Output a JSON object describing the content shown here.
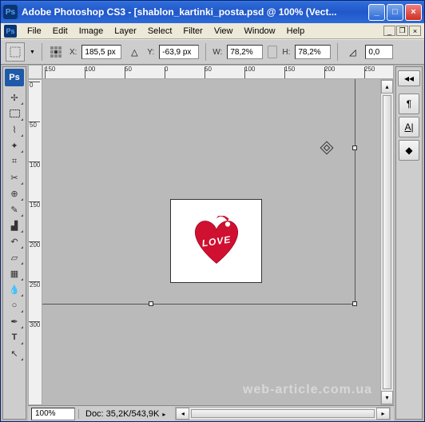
{
  "titlebar": {
    "app_icon": "Ps",
    "title": "Adobe Photoshop CS3 - [shablon_kartinki_posta.psd @ 100% (Vect..."
  },
  "menubar": {
    "icon": "Ps",
    "items": [
      "File",
      "Edit",
      "Image",
      "Layer",
      "Select",
      "Filter",
      "View",
      "Window",
      "Help"
    ]
  },
  "options": {
    "x_label": "X:",
    "x_value": "185,5 px",
    "y_label": "Y:",
    "y_value": "-63,9 px",
    "w_label": "W:",
    "w_value": "78,2%",
    "h_label": "H:",
    "h_value": "78,2%",
    "angle_value": "0,0"
  },
  "ruler_h": [
    "150",
    "100",
    "50",
    "0",
    "50",
    "100",
    "150",
    "200",
    "250"
  ],
  "ruler_v": [
    "0",
    "50",
    "100",
    "150",
    "200",
    "250",
    "300"
  ],
  "canvas": {
    "heart_text": "LOVE"
  },
  "status": {
    "zoom": "100%",
    "doc": "Doc: 35,2K/543,9K"
  },
  "watermark": "web-article.com.ua"
}
